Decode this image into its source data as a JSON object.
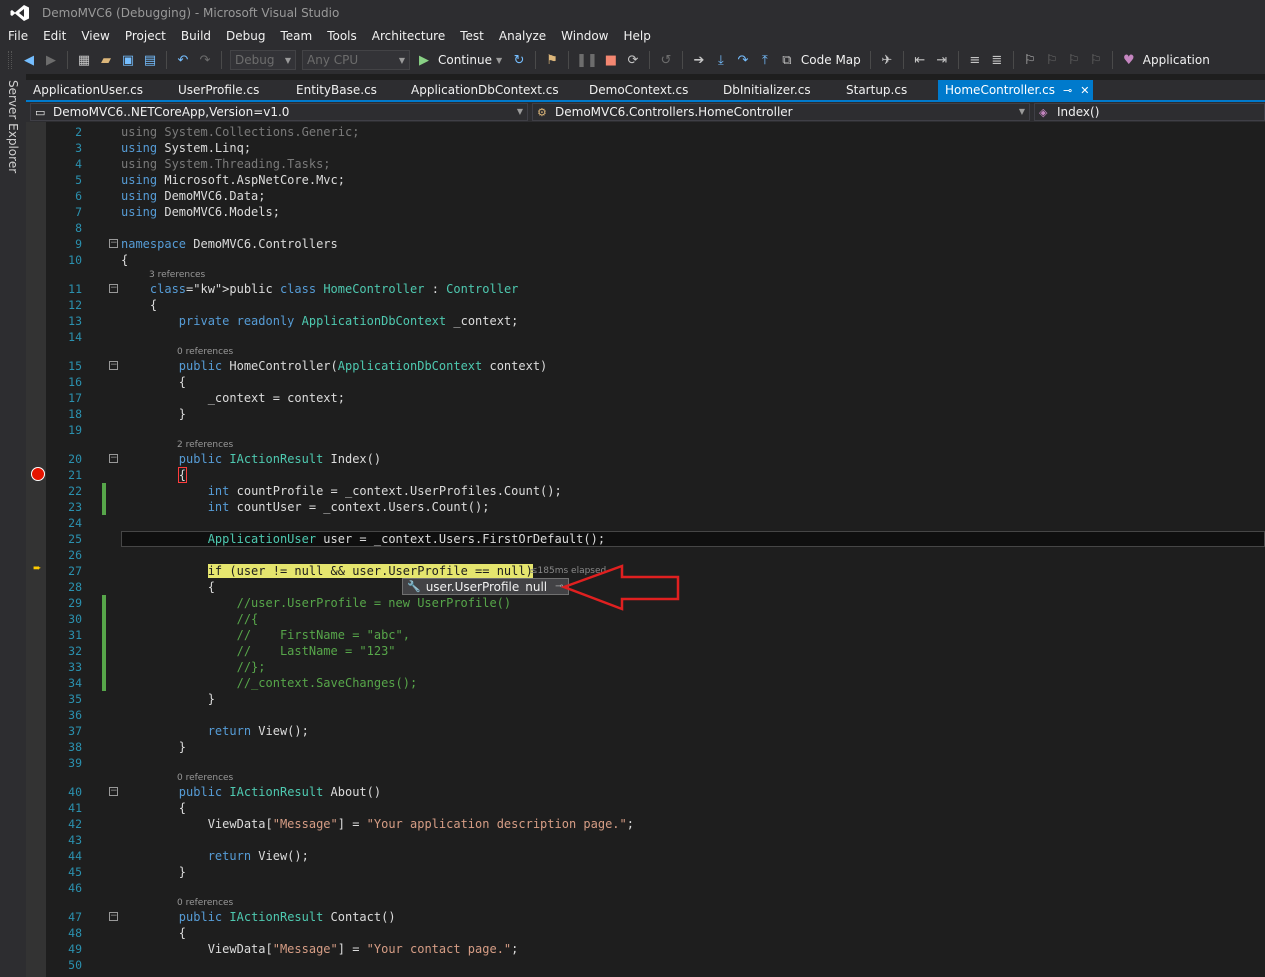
{
  "window": {
    "title": "DemoMVC6 (Debugging) - Microsoft Visual Studio"
  },
  "menu": [
    "File",
    "Edit",
    "View",
    "Project",
    "Build",
    "Debug",
    "Team",
    "Tools",
    "Architecture",
    "Test",
    "Analyze",
    "Window",
    "Help"
  ],
  "toolbar": {
    "config": "Debug",
    "platform": "Any CPU",
    "continue_label": "Continue",
    "codemap_label": "Code Map",
    "application_label": "Application"
  },
  "left_rail": {
    "label": "Server Explorer"
  },
  "tabs": [
    {
      "label": "ApplicationUser.cs"
    },
    {
      "label": "UserProfile.cs"
    },
    {
      "label": "EntityBase.cs"
    },
    {
      "label": "ApplicationDbContext.cs"
    },
    {
      "label": "DemoContext.cs"
    },
    {
      "label": "DbInitializer.cs"
    },
    {
      "label": "Startup.cs"
    },
    {
      "label": "HomeController.cs"
    }
  ],
  "navbar": {
    "project": "DemoMVC6..NETCoreApp,Version=v1.0",
    "type": "DemoMVC6.Controllers.HomeController",
    "member": "Index()"
  },
  "codelens": {
    "l11": "3 references",
    "l15": "0 references",
    "l20": "2 references",
    "l40": "0 references",
    "l47": "0 references"
  },
  "lines": [
    {
      "n": "2",
      "text": "using System.Collections.Generic;"
    },
    {
      "n": "3",
      "text": "using System.Linq;"
    },
    {
      "n": "4",
      "text": "using System.Threading.Tasks;"
    },
    {
      "n": "5",
      "text": "using Microsoft.AspNetCore.Mvc;"
    },
    {
      "n": "6",
      "text": "using DemoMVC6.Data;"
    },
    {
      "n": "7",
      "text": "using DemoMVC6.Models;"
    },
    {
      "n": "8",
      "text": ""
    },
    {
      "n": "9",
      "text": "namespace DemoMVC6.Controllers"
    },
    {
      "n": "10",
      "text": "{"
    },
    {
      "n": "11",
      "text": "    public class HomeController : Controller"
    },
    {
      "n": "12",
      "text": "    {"
    },
    {
      "n": "13",
      "text": "        private readonly ApplicationDbContext _context;"
    },
    {
      "n": "14",
      "text": ""
    },
    {
      "n": "15",
      "text": "        public HomeController(ApplicationDbContext context)"
    },
    {
      "n": "16",
      "text": "        {"
    },
    {
      "n": "17",
      "text": "            _context = context;"
    },
    {
      "n": "18",
      "text": "        }"
    },
    {
      "n": "19",
      "text": ""
    },
    {
      "n": "20",
      "text": "        public IActionResult Index()"
    },
    {
      "n": "21",
      "text": "        {"
    },
    {
      "n": "22",
      "text": "            int countProfile = _context.UserProfiles.Count();"
    },
    {
      "n": "23",
      "text": "            int countUser = _context.Users.Count();"
    },
    {
      "n": "24",
      "text": ""
    },
    {
      "n": "25",
      "text": "            ApplicationUser user = _context.Users.FirstOrDefault();"
    },
    {
      "n": "26",
      "text": ""
    },
    {
      "n": "27",
      "text": "            if (user != null && user.UserProfile == null)"
    },
    {
      "n": "28",
      "text": "            {"
    },
    {
      "n": "29",
      "text": "                //user.UserProfile = new UserProfile()"
    },
    {
      "n": "30",
      "text": "                //{"
    },
    {
      "n": "31",
      "text": "                //    FirstName = \"abc\","
    },
    {
      "n": "32",
      "text": "                //    LastName = \"123\""
    },
    {
      "n": "33",
      "text": "                //};"
    },
    {
      "n": "34",
      "text": "                //_context.SaveChanges();"
    },
    {
      "n": "35",
      "text": "            }"
    },
    {
      "n": "36",
      "text": ""
    },
    {
      "n": "37",
      "text": "            return View();"
    },
    {
      "n": "38",
      "text": "        }"
    },
    {
      "n": "39",
      "text": ""
    },
    {
      "n": "40",
      "text": "        public IActionResult About()"
    },
    {
      "n": "41",
      "text": "        {"
    },
    {
      "n": "42",
      "text": "            ViewData[\"Message\"] = \"Your application description page.\";"
    },
    {
      "n": "43",
      "text": ""
    },
    {
      "n": "44",
      "text": "            return View();"
    },
    {
      "n": "45",
      "text": "        }"
    },
    {
      "n": "46",
      "text": ""
    },
    {
      "n": "47",
      "text": "        public IActionResult Contact()"
    },
    {
      "n": "48",
      "text": "        {"
    },
    {
      "n": "49",
      "text": "            ViewData[\"Message\"] = \"Your contact page.\";"
    },
    {
      "n": "50",
      "text": ""
    }
  ],
  "debug": {
    "elapsed": "≤185ms elapsed",
    "datatip_expr": "user.UserProfile",
    "datatip_value": "null"
  },
  "colors": {
    "accent": "#007acc",
    "keyword": "#569cd6",
    "type": "#4ec9b0",
    "string": "#d69d85",
    "comment": "#57a64a",
    "breakpoint": "#e51400",
    "annotation": "#e02020"
  }
}
